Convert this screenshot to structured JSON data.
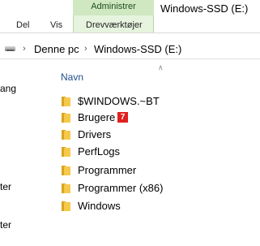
{
  "window": {
    "title": "Windows-SSD (E:)"
  },
  "ribbon": {
    "context_group": "Administrer",
    "tabs": [
      {
        "label": "Del"
      },
      {
        "label": "Vis"
      },
      {
        "label": "Drevværktøjer"
      }
    ]
  },
  "address": {
    "breadcrumbs": [
      "Denne pc",
      "Windows-SSD (E:)"
    ]
  },
  "navpane": {
    "items": [
      "ang",
      "ter",
      "ter"
    ]
  },
  "content": {
    "column_header": "Navn",
    "files": [
      {
        "name": "$WINDOWS.~BT"
      },
      {
        "name": "Brugere"
      },
      {
        "name": "Drivers"
      },
      {
        "name": "PerfLogs"
      },
      {
        "name": "Programmer"
      },
      {
        "name": "Programmer (x86)"
      },
      {
        "name": "Windows"
      }
    ],
    "badge": "7"
  },
  "colors": {
    "context_tab_header": "#cfe8c2",
    "context_tab_body": "#e6f3de",
    "folder": "#f6c94a",
    "badge": "#e02020",
    "column_header": "#1f4f8e"
  }
}
